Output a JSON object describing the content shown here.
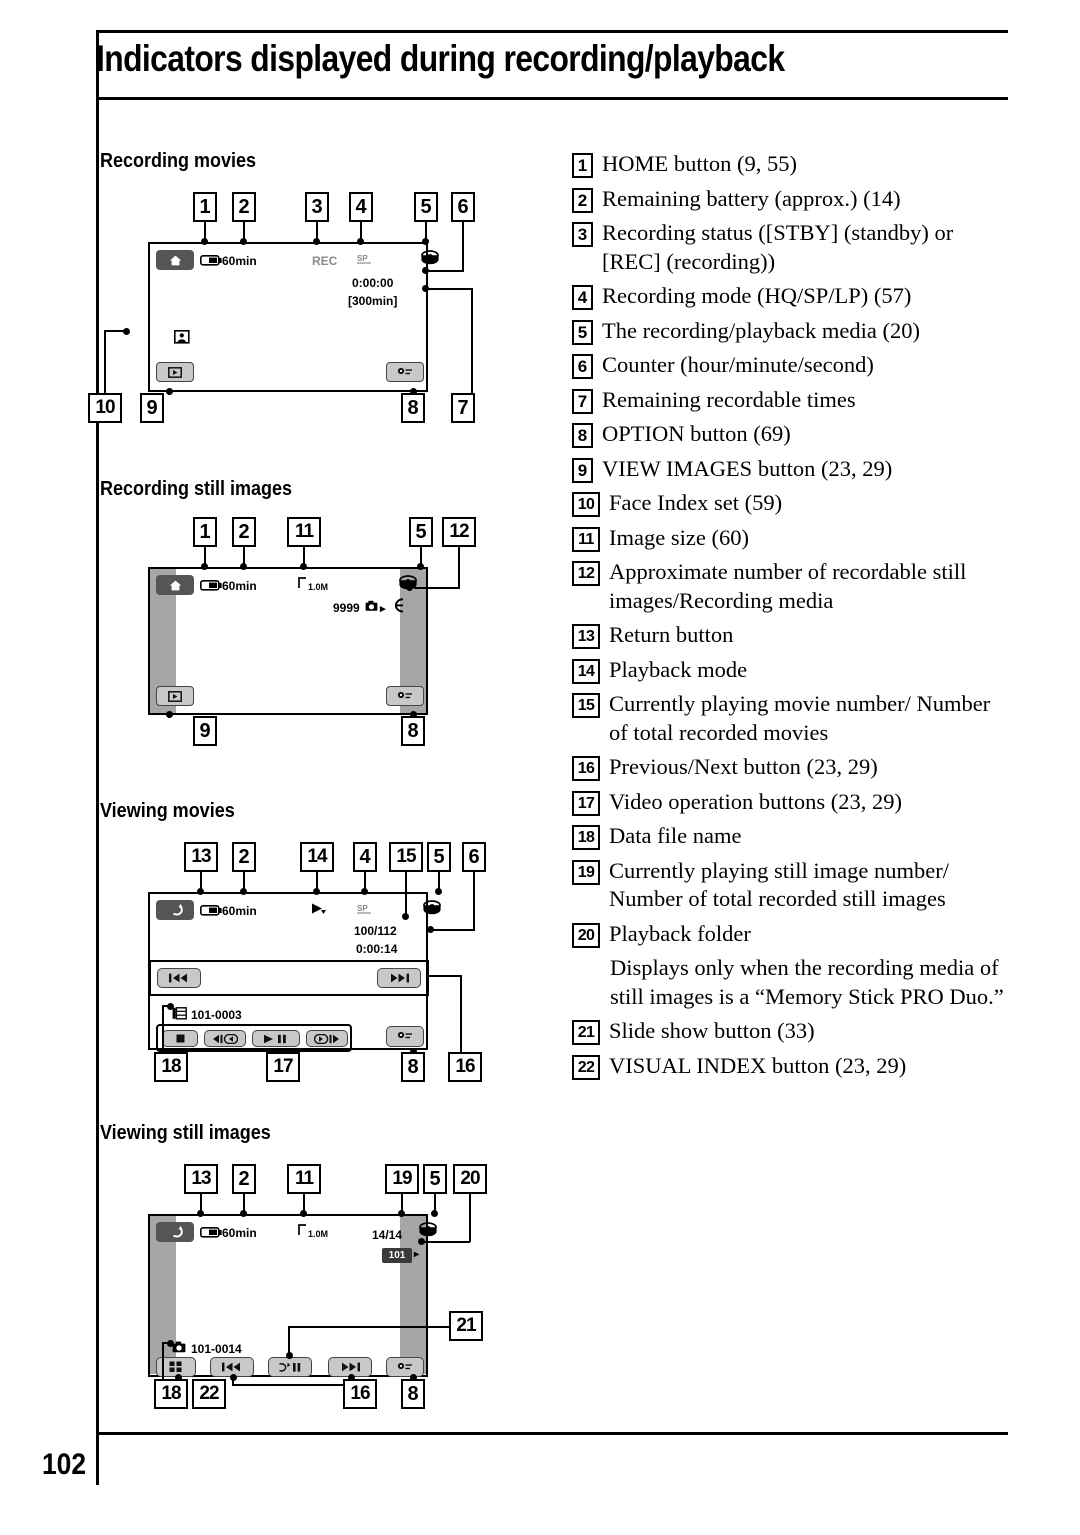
{
  "document": {
    "title": "Indicators displayed during recording/playback",
    "page_number": "102"
  },
  "sections": [
    {
      "heading": "Recording movies"
    },
    {
      "heading": "Recording still images"
    },
    {
      "heading": "Viewing movies"
    },
    {
      "heading": "Viewing still images"
    }
  ],
  "diagram_recording_movies": {
    "callouts": [
      "1",
      "2",
      "3",
      "4",
      "5",
      "6",
      "10",
      "9",
      "8",
      "7"
    ],
    "battery_text": "60min",
    "rec_status": "REC",
    "counter": "0:00:00",
    "remaining": "[300min]"
  },
  "diagram_recording_still": {
    "callouts": [
      "1",
      "2",
      "11",
      "5",
      "12",
      "9",
      "8"
    ],
    "battery_text": "60min",
    "image_size": "1.0M",
    "recordable_count": "9999"
  },
  "diagram_viewing_movies": {
    "callouts": [
      "13",
      "2",
      "14",
      "4",
      "15",
      "5",
      "6",
      "18",
      "17",
      "8",
      "16"
    ],
    "battery_text": "60min",
    "movie_number": "100/112",
    "counter": "0:00:14",
    "file_name": "101-0003"
  },
  "diagram_viewing_still": {
    "callouts": [
      "13",
      "2",
      "11",
      "19",
      "5",
      "20",
      "18",
      "22",
      "16",
      "8",
      "21"
    ],
    "battery_text": "60min",
    "image_size": "1.0M",
    "image_number": "14/14",
    "folder": "101",
    "file_name": "101-0014"
  },
  "legend": [
    {
      "num": "1",
      "text": "HOME button (9, 55)"
    },
    {
      "num": "2",
      "text": "Remaining battery (approx.) (14)"
    },
    {
      "num": "3",
      "text": "Recording status ([STBY] (standby) or [REC] (recording))"
    },
    {
      "num": "4",
      "text": "Recording mode (HQ/SP/LP) (57)"
    },
    {
      "num": "5",
      "text": "The recording/playback media (20)"
    },
    {
      "num": "6",
      "text": "Counter (hour/minute/second)"
    },
    {
      "num": "7",
      "text": "Remaining recordable times"
    },
    {
      "num": "8",
      "text": "OPTION button (69)"
    },
    {
      "num": "9",
      "text": "VIEW IMAGES button (23, 29)"
    },
    {
      "num": "10",
      "text": "Face Index set (59)"
    },
    {
      "num": "11",
      "text": "Image size (60)"
    },
    {
      "num": "12",
      "text": "Approximate number of recordable still images/Recording media"
    },
    {
      "num": "13",
      "text": "Return button"
    },
    {
      "num": "14",
      "text": "Playback mode"
    },
    {
      "num": "15",
      "text": "Currently playing movie number/ Number of total recorded movies"
    },
    {
      "num": "16",
      "text": "Previous/Next button (23, 29)"
    },
    {
      "num": "17",
      "text": "Video operation buttons (23, 29)"
    },
    {
      "num": "18",
      "text": "Data file name"
    },
    {
      "num": "19",
      "text": "Currently playing still image number/ Number of total recorded still images"
    },
    {
      "num": "20",
      "text": "Playback folder",
      "sub": "Displays only when the recording media of still images is a “Memory Stick PRO Duo.”"
    },
    {
      "num": "21",
      "text": "Slide show button (33)"
    },
    {
      "num": "22",
      "text": "VISUAL INDEX button (23, 29)"
    }
  ]
}
